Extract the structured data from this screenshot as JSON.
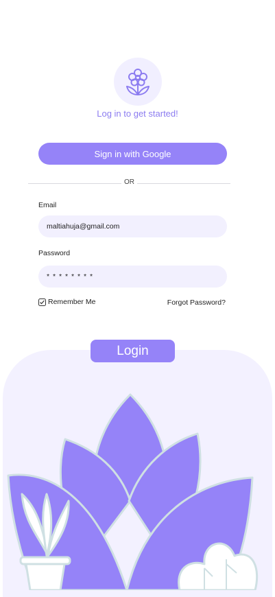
{
  "header": {
    "tagline": "Log in to get started!"
  },
  "google_button": {
    "label": "Sign in with Google"
  },
  "divider": {
    "text": "OR"
  },
  "email": {
    "label": "Email",
    "value": "maltiahuja@gmail.com"
  },
  "password": {
    "label": "Password",
    "value": "* * * * * * * *"
  },
  "options": {
    "remember_label": "Remember Me",
    "remember_checked": true,
    "forgot_label": "Forgot Password?"
  },
  "login_button": {
    "label": "Login"
  },
  "icons": {
    "logo": "flower-icon",
    "checkbox": "checkbox-checked-icon"
  },
  "colors": {
    "accent": "#9583f8",
    "accent_text": "#8c7cf0",
    "field_bg": "#f2f0fe",
    "illustration_bg": "#f3f1ff",
    "leaf_outline": "#cfe0e3"
  }
}
